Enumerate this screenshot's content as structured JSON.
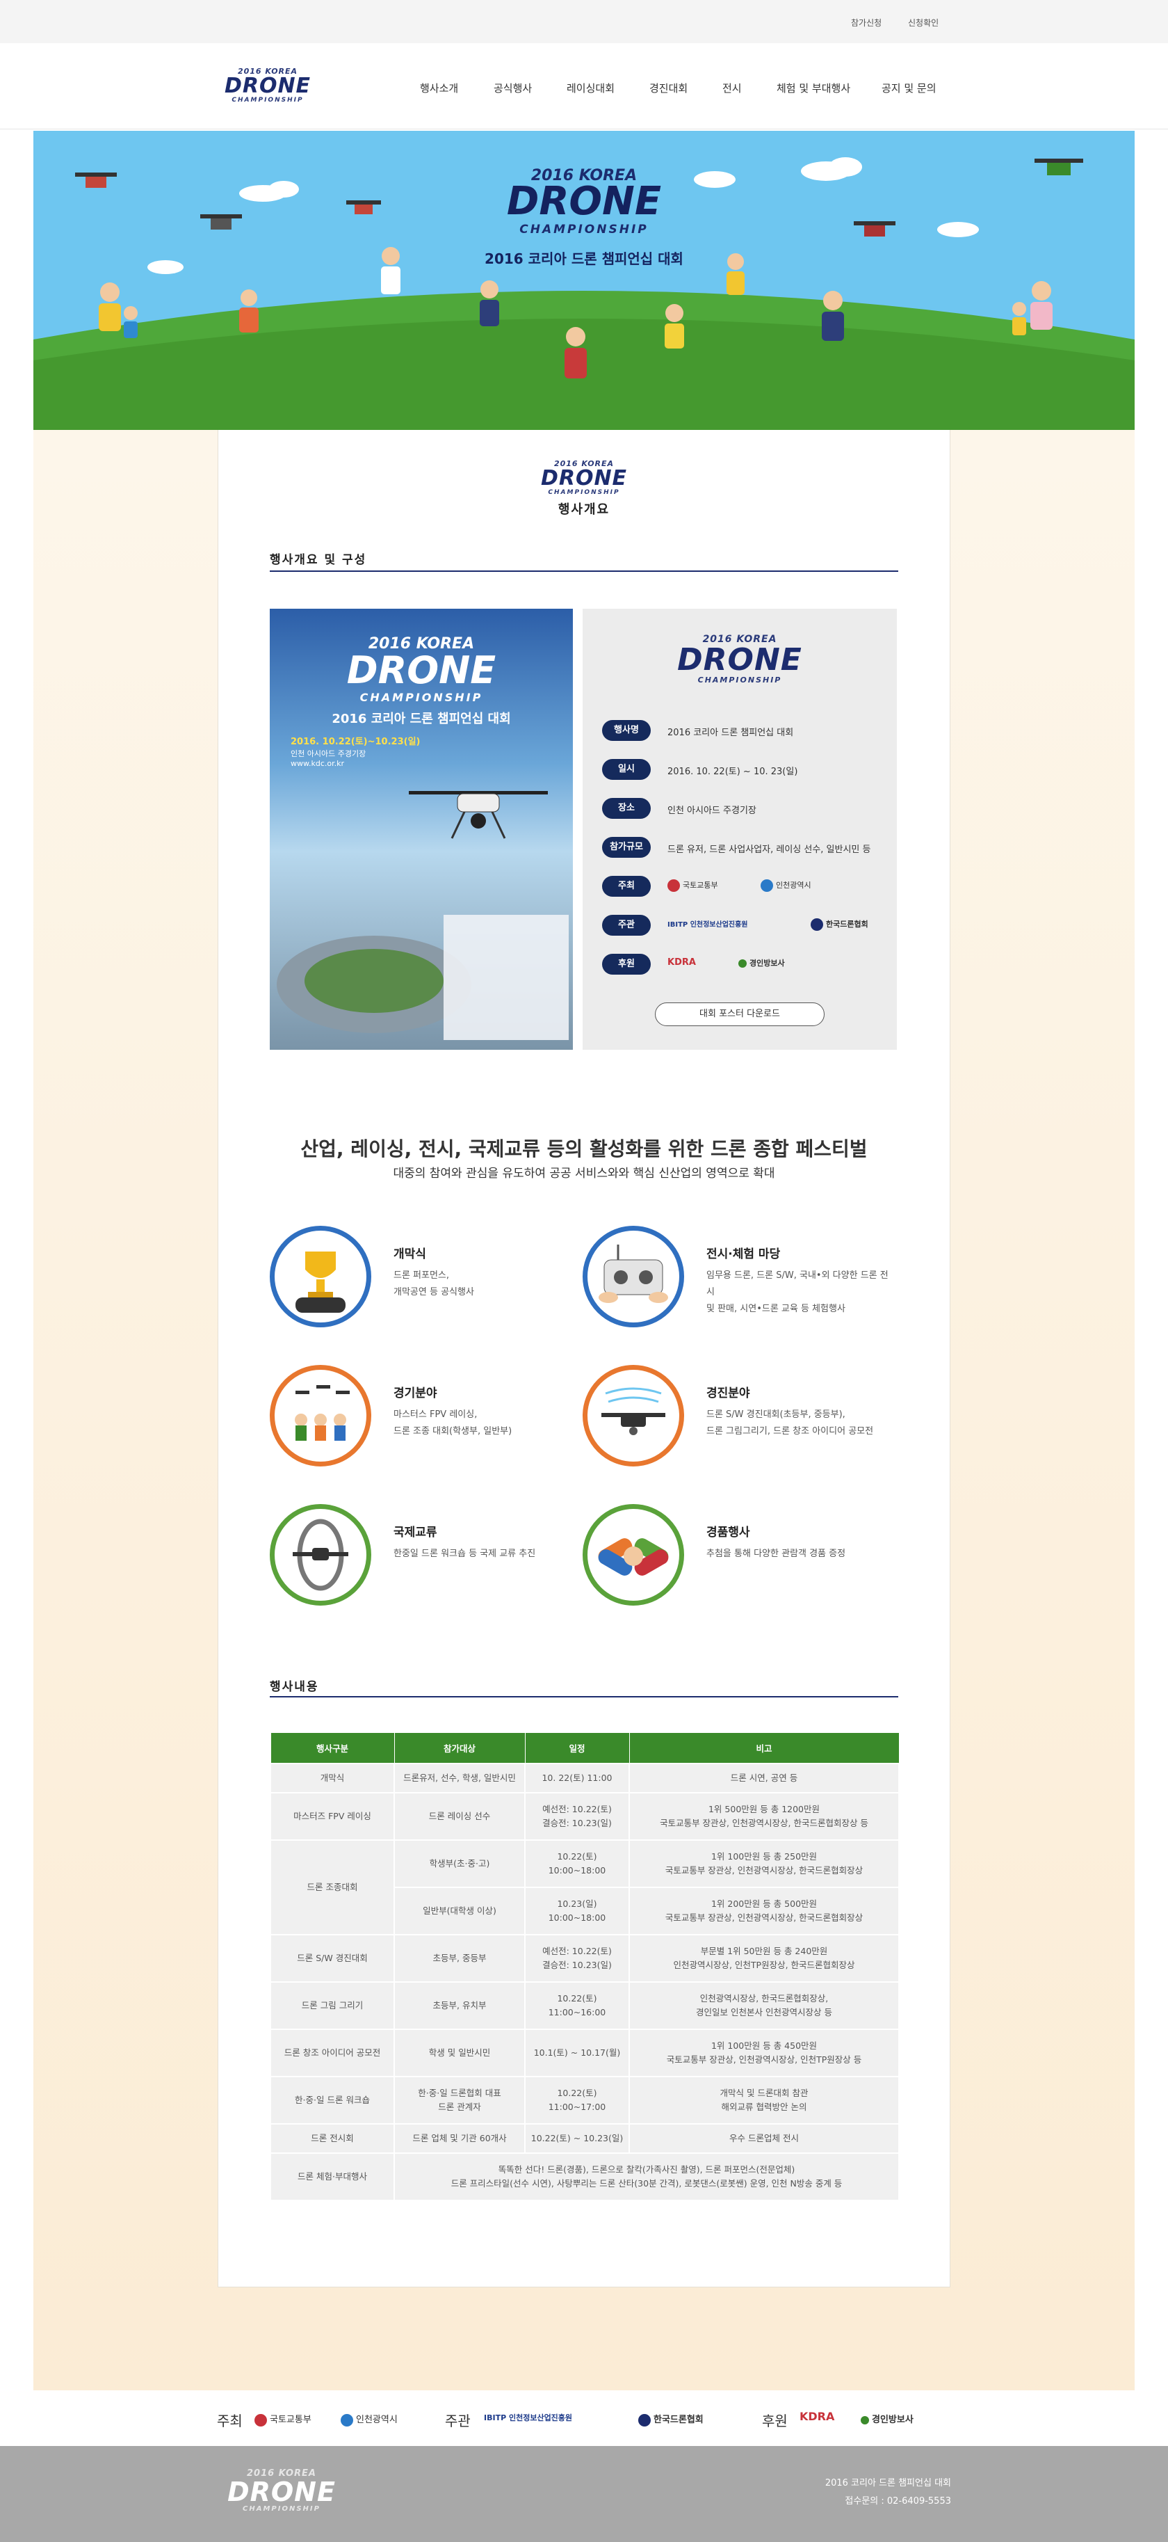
{
  "topbar": {
    "links": [
      "참가신청",
      "신청확인"
    ]
  },
  "header": {
    "logo": {
      "line1": "2016 KOREA",
      "line2": "DRONE",
      "line3": "CHAMPIONSHIP"
    },
    "nav": [
      "행사소개",
      "공식행사",
      "레이싱대회",
      "경진대회",
      "전시",
      "체험 및 부대행사",
      "공지 및 문의"
    ]
  },
  "hero": {
    "line1": "2016 KOREA",
    "line2": "DRONE",
    "line3": "CHAMPIONSHIP",
    "subtitle": "2016 코리아 드론 챔피언십 대회"
  },
  "intro": {
    "logo": {
      "line1": "2016 KOREA",
      "line2": "DRONE",
      "line3": "CHAMPIONSHIP"
    },
    "page_title": "행사개요"
  },
  "overview": {
    "section_title": "행사개요 및 구성",
    "poster": {
      "line1": "2016 KOREA",
      "line2": "DRONE",
      "line3": "CHAMPIONSHIP",
      "subtitle": "2016 코리아 드론 챔피언십 대회",
      "date": "2016. 10.22(토)~10.23(일)",
      "venue": "인천 아시아드 주경기장",
      "url": "www.kdc.or.kr"
    },
    "info_logo": {
      "line1": "2016 KOREA",
      "line2": "DRONE",
      "line3": "CHAMPIONSHIP"
    },
    "rows": [
      {
        "label": "행사명",
        "value": "2016 코리아 드론 챔피언십 대회"
      },
      {
        "label": "일시",
        "value": "2016. 10. 22(토) ~ 10. 23(일)"
      },
      {
        "label": "장소",
        "value": "인천 아시아드 주경기장"
      },
      {
        "label": "참가규모",
        "value": "드론 유저, 드론 사업사업자, 레이싱 선수, 일반시민 등"
      },
      {
        "label": "주최",
        "value": ""
      },
      {
        "label": "주관",
        "value": ""
      },
      {
        "label": "후원",
        "value": ""
      }
    ],
    "host_logos": [
      "국토교통부",
      "인천광역시"
    ],
    "organizer_logos": [
      "IBITP 인천정보산업진흥원",
      "한국드론협회"
    ],
    "sponsor_logos": [
      "KDRA",
      "경인방보사"
    ],
    "download_label": "대회 포스터 다운로드"
  },
  "headline": {
    "title": "산업, 레이싱, 전시, 국제교류 등의 활성화를 위한 드론 종합 페스티벌",
    "subtitle": "대중의 참여와 관심을 유도하여 공공 서비스와와 핵심 신산업의 영역으로 확대"
  },
  "features": [
    {
      "title": "개막식",
      "desc": "드론 퍼포먼스,\n개막공연 등 공식행사",
      "icon": "trophy-icon"
    },
    {
      "title": "전시·체험 마당",
      "desc": "임무용 드론, 드론 S/W, 국내•외 다양한 드론 전시\n및 판매, 시연•드론 교육 등 체험행사",
      "icon": "controller-icon"
    },
    {
      "title": "경기분야",
      "desc": "마스터스 FPV 레이싱,\n드론 조종 대회(학생부, 일반부)",
      "icon": "racing-icon"
    },
    {
      "title": "경진분야",
      "desc": "드론 S/W 경진대회(초등부, 중등부),\n드론 그림그리기, 드론 창조 아이디어 공모전",
      "icon": "drone-icon"
    },
    {
      "title": "국제교류",
      "desc": "한중일 드론 워크숍 등 국제 교류 추진",
      "icon": "ring-drone-icon"
    },
    {
      "title": "경품행사",
      "desc": "추첨을 통해 다양한 관람객 경품 증정",
      "icon": "hands-icon"
    }
  ],
  "schedule": {
    "section_title": "행사내용",
    "headers": [
      "행사구분",
      "참가대상",
      "일정",
      "비고"
    ],
    "rows": [
      [
        "개막식",
        "드론유저, 선수, 학생, 일반시민",
        "10. 22(토) 11:00",
        "드론 시연, 공연 등"
      ],
      [
        "마스터즈 FPV 레이싱",
        "드론 레이싱 선수",
        "예선전: 10.22(토)\n결승전: 10.23(일)",
        "1위 500만원 등 총 1200만원\n국토교통부 장관상, 인천광역시장상, 한국드론협회장상 등"
      ],
      [
        "드론 조종대회",
        "학생부(초·중·고)",
        "10.22(토) 10:00~18:00",
        "1위 100만원 등 총 250만원\n국토교통부 장관상, 인천광역시장상, 한국드론협회장상"
      ],
      [
        "",
        "일반부(대학생 이상)",
        "10.23(일) 10:00~18:00",
        "1위 200만원 등 총 500만원\n국토교통부 장관상, 인천광역시장상, 한국드론협회장상"
      ],
      [
        "드론 S/W 경진대회",
        "초등부, 중등부",
        "예선전: 10.22(토)\n결승전: 10.23(일)",
        "부문별 1위 50만원 등 총 240만원\n인천광역시장상, 인천TP원장상, 한국드론협회장상"
      ],
      [
        "드론 그림 그리기",
        "초등부, 유치부",
        "10.22(토) 11:00~16:00",
        "인천광역시장상, 한국드론협회장상,\n경인일보 인천본사 인천광역시장상 등"
      ],
      [
        "드론 창조 아이디어 공모전",
        "학생 및 일반시민",
        "10.1(토) ~ 10.17(월)",
        "1위 100만원 등 총 450만원\n국토교통부 장관상, 인천광역시장상, 인천TP원장상 등"
      ],
      [
        "한·중·일 드론 워크숍",
        "한·중·일 드론협회 대표\n드론 관계자",
        "10.22(토) 11:00~17:00",
        "개막식 및 드론대회 참관\n해외교류 협력방안 논의"
      ],
      [
        "드론 전시회",
        "드론 업체 및 기관 60개사",
        "10.22(토) ~ 10.23(일)",
        "우수 드론업체 전시"
      ],
      [
        "드론 체험·부대행사",
        "똑똑한 선다! 드론(경품), 드론으로 찰칵(가족사진 촬영), 드론 퍼포먼스(전문업체)\n드론 프리스타일(선수 시연), 사탕뿌리는 드론 산타(30분 간격), 로봇댄스(로봇쌘) 운영, 인천 N방송 중계 등",
        "",
        ""
      ]
    ]
  },
  "sponsors": {
    "host_label": "주최",
    "host": [
      "국토교통부",
      "인천광역시"
    ],
    "organizer_label": "주관",
    "organizer": [
      "IBITP 인천정보산업진흥원",
      "한국드론협회"
    ],
    "support_label": "후원",
    "support": [
      "KDRA",
      "경인방보사"
    ]
  },
  "footer": {
    "logo": {
      "line1": "2016 KOREA",
      "line2": "DRONE",
      "line3": "CHAMPIONSHIP"
    },
    "event_name": "2016 코리아 드론 챔피언십 대회",
    "contact": "접수문의 : 02-6409-5553"
  },
  "colors": {
    "navy": "#1c2c6e",
    "green": "#3a8a2a",
    "sky": "#6ec6f0",
    "blue_ring": "#2f6fc0",
    "orange_ring": "#e8772e",
    "green_ring": "#5aa23a"
  }
}
